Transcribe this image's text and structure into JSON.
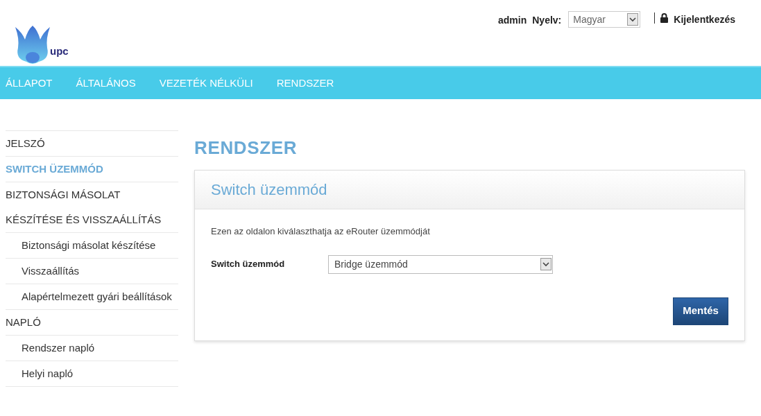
{
  "logo": {
    "text": "upc"
  },
  "header": {
    "user": "admin",
    "language_label": "Nyelv:",
    "language": "Magyar",
    "logout": "Kijelentkezés"
  },
  "nav": [
    {
      "label": "ÁLLAPOT"
    },
    {
      "label": "ÁLTALÁNOS"
    },
    {
      "label": "VEZETÉK NÉLKÜLI"
    },
    {
      "label": "RENDSZER"
    }
  ],
  "sidebar": {
    "items": [
      {
        "kind": "section",
        "label": "JELSZÓ",
        "selected": false
      },
      {
        "kind": "section",
        "label": "SWITCH ÜZEMMÓD",
        "selected": true
      },
      {
        "kind": "section",
        "label": "BIZTONSÁGI MÁSOLAT KÉSZÍTÉSE ÉS VISSZAÁLLÍTÁS",
        "selected": false
      },
      {
        "kind": "sub",
        "label": "Biztonsági másolat készítése",
        "selected": false
      },
      {
        "kind": "sub",
        "label": "Visszaállítás",
        "selected": false
      },
      {
        "kind": "sub",
        "label": "Alapértelmezett gyári beállítások",
        "selected": false
      },
      {
        "kind": "section",
        "label": "NAPLÓ",
        "selected": false
      },
      {
        "kind": "sub",
        "label": "Rendszer napló",
        "selected": false
      },
      {
        "kind": "sub",
        "label": "Helyi napló",
        "selected": false
      }
    ]
  },
  "page_title": "RENDSZER",
  "panel": {
    "title": "Switch üzemmód",
    "description": "Ezen az oldalon kiválaszthatja az eRouter üzemmódját",
    "field_label": "Switch üzemmód",
    "field_value": "Bridge üzemmód",
    "save_button": "Mentés"
  }
}
